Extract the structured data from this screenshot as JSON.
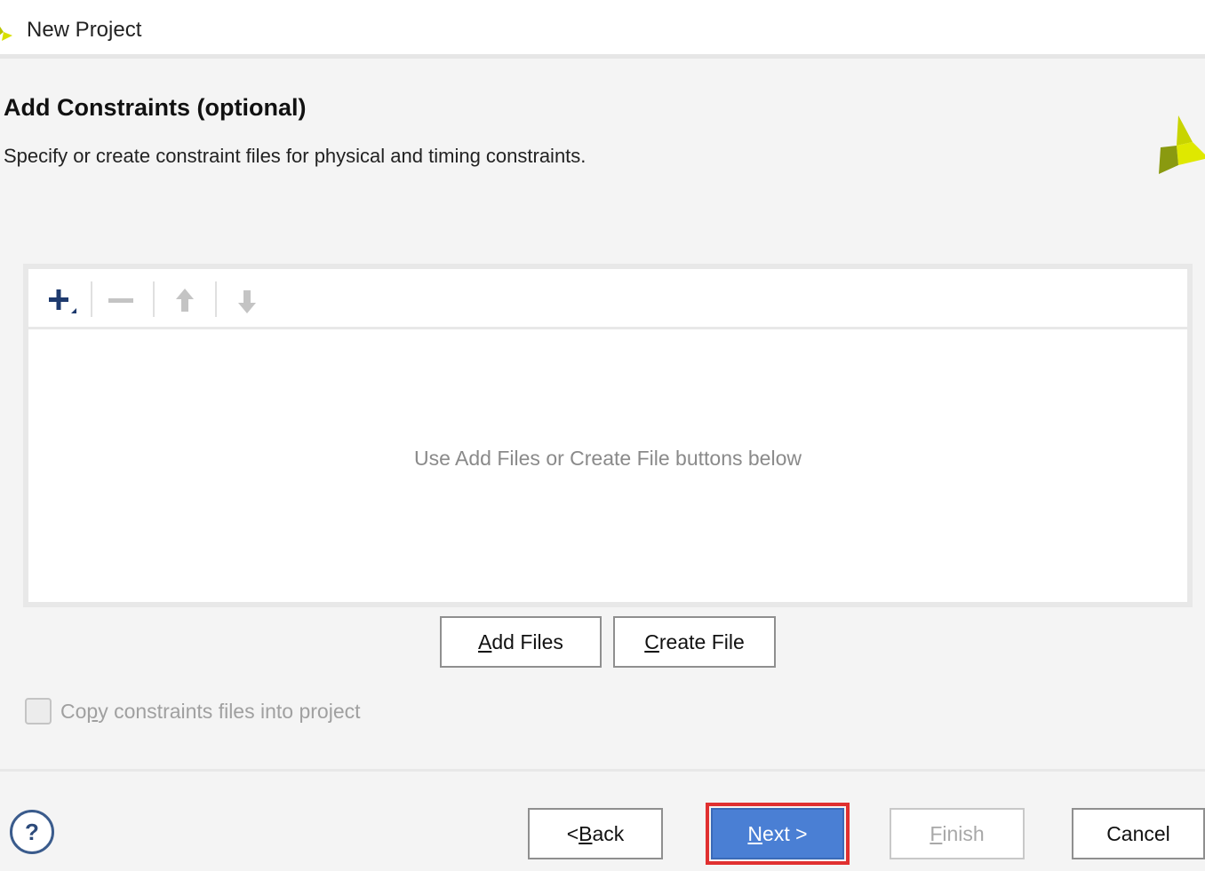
{
  "window": {
    "title": "New Project",
    "icon": "vivado-logo-icon"
  },
  "header": {
    "heading": "Add Constraints (optional)",
    "description": "Specify or create constraint files for physical and timing constraints.",
    "logo": "vivado-logo-icon"
  },
  "toolbar": {
    "items": [
      {
        "icon": "add-icon",
        "enabled": true
      },
      {
        "icon": "remove-icon",
        "enabled": false
      },
      {
        "icon": "move-up-icon",
        "enabled": false
      },
      {
        "icon": "move-down-icon",
        "enabled": false
      }
    ]
  },
  "file_list": {
    "empty_message": "Use Add Files or Create File buttons below"
  },
  "buttons": {
    "add_files": {
      "mnemonic": "A",
      "rest": "dd Files"
    },
    "create_file": {
      "mnemonic": "C",
      "rest": "reate File"
    }
  },
  "copy_option": {
    "label_pre": "Co",
    "label_mnemonic": "p",
    "label_post": "y constraints files into project",
    "checked": false,
    "enabled": false
  },
  "footer": {
    "help_label": "?",
    "back": {
      "pre": "< ",
      "mnemonic": "B",
      "rest": "ack"
    },
    "next": {
      "pre": "",
      "mnemonic": "N",
      "rest": "ext >"
    },
    "finish": {
      "pre": "",
      "mnemonic": "F",
      "rest": "inish"
    },
    "cancel": "Cancel"
  },
  "colors": {
    "primary": "#4a7fd4",
    "highlight": "#e03030",
    "brand": "#c8d400"
  }
}
